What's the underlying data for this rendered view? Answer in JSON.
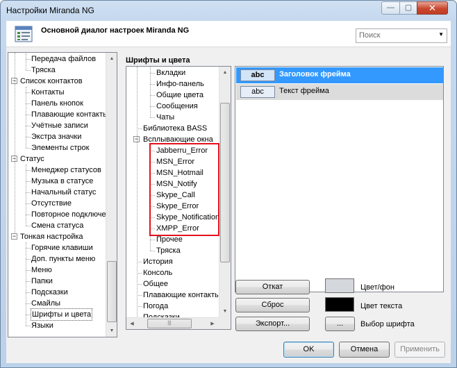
{
  "window": {
    "title": "Настройки Miranda NG",
    "min_glyph": "—",
    "max_glyph": "▢",
    "close_glyph": "✕"
  },
  "header": {
    "title": "Основной диалог настроек Miranda NG",
    "icon": "settings-dialog-icon"
  },
  "search": {
    "placeholder": "Поиск",
    "icon": "dropdown-arrow-icon"
  },
  "left_tree": {
    "items": [
      {
        "label": "Передача файлов"
      },
      {
        "label": "Тряска"
      },
      {
        "label": "Список контактов",
        "toggle": "−"
      },
      {
        "label": "Контакты"
      },
      {
        "label": "Панель кнопок"
      },
      {
        "label": "Плавающие контакты"
      },
      {
        "label": "Учётные записи"
      },
      {
        "label": "Экстра значки"
      },
      {
        "label": "Элементы строк"
      },
      {
        "label": "Статус",
        "toggle": "−"
      },
      {
        "label": "Менеджер статусов"
      },
      {
        "label": "Музыка в статусе"
      },
      {
        "label": "Начальный статус"
      },
      {
        "label": "Отсутствие"
      },
      {
        "label": "Повторное подключение"
      },
      {
        "label": "Смена статуса"
      },
      {
        "label": "Тонкая настройка",
        "toggle": "−"
      },
      {
        "label": "Горячие клавиши"
      },
      {
        "label": "Доп. пункты меню"
      },
      {
        "label": "Меню"
      },
      {
        "label": "Папки"
      },
      {
        "label": "Подсказки"
      },
      {
        "label": "Смайлы"
      },
      {
        "label": "Шрифты и цвета"
      },
      {
        "label": "Языки"
      }
    ]
  },
  "section_title": "Шрифты и цвета",
  "font_tree": {
    "items": [
      {
        "label": "Вкладки"
      },
      {
        "label": "Инфо-панель"
      },
      {
        "label": "Общие цвета"
      },
      {
        "label": "Сообщения"
      },
      {
        "label": "Чаты"
      },
      {
        "label": "Библиотека BASS"
      },
      {
        "label": "Всплывающие окна",
        "toggle": "−"
      },
      {
        "label": "Jabberru_Error"
      },
      {
        "label": "MSN_Error"
      },
      {
        "label": "MSN_Hotmail"
      },
      {
        "label": "MSN_Notify"
      },
      {
        "label": "Skype_Call"
      },
      {
        "label": "Skype_Error"
      },
      {
        "label": "Skype_Notification"
      },
      {
        "label": "XMPP_Error"
      },
      {
        "label": "Прочее"
      },
      {
        "label": "Тряска"
      },
      {
        "label": "История"
      },
      {
        "label": "Консоль"
      },
      {
        "label": "Общее"
      },
      {
        "label": "Плавающие контакты"
      },
      {
        "label": "Погода"
      },
      {
        "label": "Подсказки"
      }
    ]
  },
  "font_list": {
    "items": [
      {
        "sample": "abc",
        "label": "Заголовок фрейма",
        "selected": true
      },
      {
        "sample": "abc",
        "label": "Текст фрейма",
        "selected": false
      }
    ]
  },
  "controls": {
    "undo": "Откат",
    "reset": "Сброс",
    "export": "Экспорт...",
    "color_bg_label": "Цвет/фон",
    "color_bg": "#d4d8dc",
    "color_text_label": "Цвет текста",
    "color_text": "#000000",
    "choose_font_label": "Выбор шрифта",
    "choose_font_button": "..."
  },
  "footer": {
    "ok": "OK",
    "cancel": "Отмена",
    "apply": "Применить"
  },
  "colors": {
    "selection": "#3399ff",
    "highlight_box": "#e3111b"
  },
  "scroll_glyphs": {
    "up": "▲",
    "down": "▼",
    "left": "◀",
    "right": "▶",
    "grip": "|||"
  }
}
